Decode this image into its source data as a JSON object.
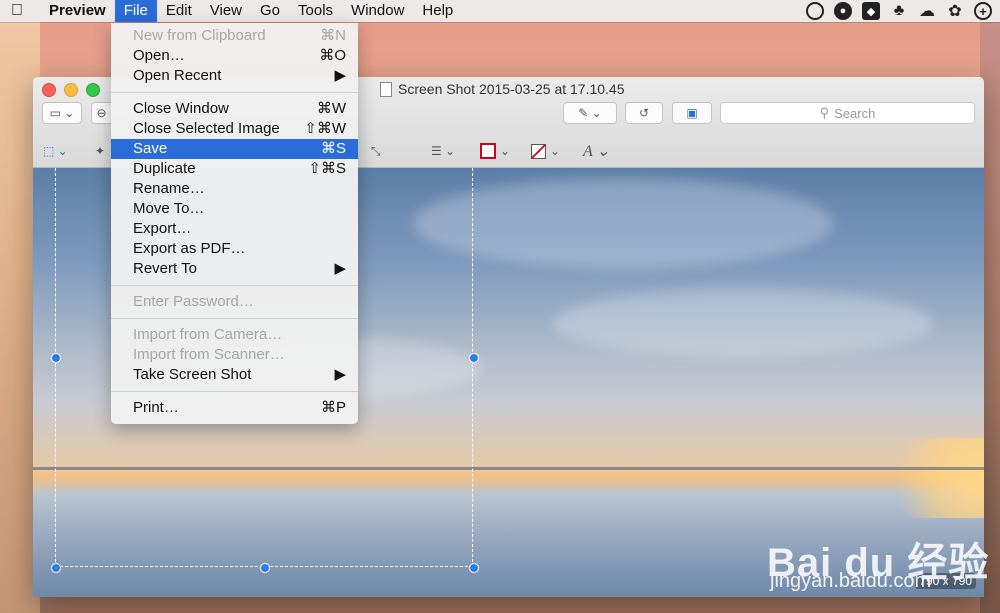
{
  "menubar": {
    "app_name": "Preview",
    "items": [
      "File",
      "Edit",
      "View",
      "Go",
      "Tools",
      "Window",
      "Help"
    ],
    "active": "File"
  },
  "window": {
    "title": "Screen Shot 2015-03-25 at 17.10.45",
    "search_placeholder": "Search",
    "image_dimensions": "790 x 790"
  },
  "file_menu": {
    "groups": [
      [
        {
          "label": "New from Clipboard",
          "shortcut": "⌘N",
          "enabled": false
        },
        {
          "label": "Open…",
          "shortcut": "⌘O",
          "enabled": true
        },
        {
          "label": "Open Recent",
          "shortcut": "▶",
          "enabled": true
        }
      ],
      [
        {
          "label": "Close Window",
          "shortcut": "⌘W",
          "enabled": true
        },
        {
          "label": "Close Selected Image",
          "shortcut": "⇧⌘W",
          "enabled": true
        },
        {
          "label": "Save",
          "shortcut": "⌘S",
          "enabled": true,
          "highlighted": true
        },
        {
          "label": "Duplicate",
          "shortcut": "⇧⌘S",
          "enabled": true
        },
        {
          "label": "Rename…",
          "shortcut": "",
          "enabled": true
        },
        {
          "label": "Move To…",
          "shortcut": "",
          "enabled": true
        },
        {
          "label": "Export…",
          "shortcut": "",
          "enabled": true
        },
        {
          "label": "Export as PDF…",
          "shortcut": "",
          "enabled": true
        },
        {
          "label": "Revert To",
          "shortcut": "▶",
          "enabled": true
        }
      ],
      [
        {
          "label": "Enter Password…",
          "shortcut": "",
          "enabled": false
        }
      ],
      [
        {
          "label": "Import from Camera…",
          "shortcut": "",
          "enabled": false
        },
        {
          "label": "Import from Scanner…",
          "shortcut": "",
          "enabled": false
        },
        {
          "label": "Take Screen Shot",
          "shortcut": "▶",
          "enabled": true
        }
      ],
      [
        {
          "label": "Print…",
          "shortcut": "⌘P",
          "enabled": true
        }
      ]
    ]
  },
  "watermark": {
    "brand": "Bai du 经验",
    "url": "jingyan.baidu.com"
  },
  "colors": {
    "highlight": "#2a6cd8",
    "selection_handle": "#2d7be5",
    "close": "#fc605c",
    "minimize": "#fdbc40",
    "zoom": "#34c84a"
  }
}
